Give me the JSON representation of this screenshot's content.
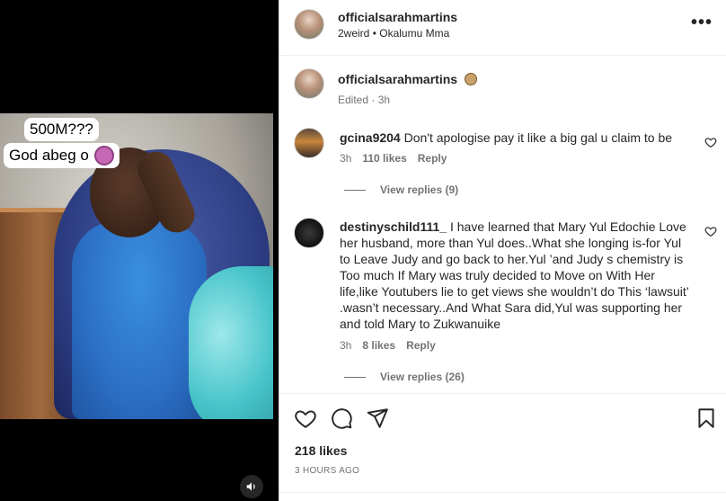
{
  "post": {
    "author": "officialsarahmartins",
    "audio": "2weird",
    "separator": "•",
    "location": "Okalumu Mma",
    "more_label": "•••"
  },
  "media": {
    "caption_line1": "500M???",
    "caption_line2": "God abeg o"
  },
  "caption": {
    "author": "officialsarahmartins",
    "edited": "Edited",
    "time": "3h"
  },
  "comments": [
    {
      "user": "gcina9204",
      "text": "Don't apologise pay it like a big gal u claim to be",
      "time": "3h",
      "likes": "110 likes",
      "reply": "Reply",
      "view_replies": "View replies (9)"
    },
    {
      "user": "destinyschild111_",
      "text_lines": [
        "I have learned that Mary Yul Edochie Love",
        "her husband, more than Yul does..What she longing is-for Yul",
        "to Leave Judy and go back to her.Yul ’and Judy s chemistry is",
        "Too much If Mary was truly decided to Move on With Her",
        "life,like Youtubers lie to get views she wouldn’t do This ‘lawsuit’",
        ".wasn’t necessary..And What Sara did,Yul was supporting her",
        "and told Mary to Zukwanuike"
      ],
      "time": "3h",
      "likes": "8 likes",
      "reply": "Reply",
      "view_replies": "View replies (26)"
    }
  ],
  "footer": {
    "likes": "218 likes",
    "timestamp": "3 HOURS AGO"
  },
  "colors": {
    "text": "#262626",
    "muted": "#737373",
    "border": "#dbdbdb"
  }
}
